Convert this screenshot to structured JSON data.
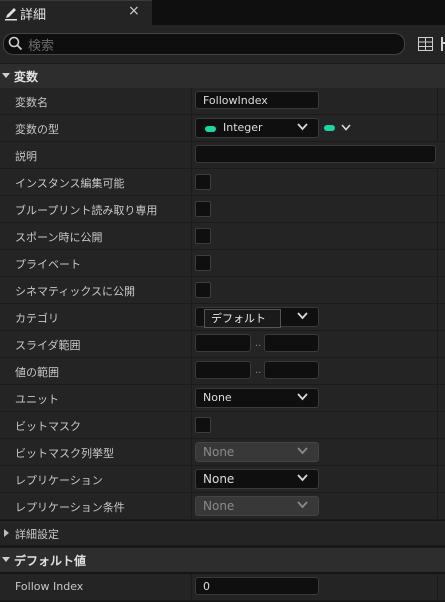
{
  "tab": {
    "title": "詳細",
    "close_glyph": "×"
  },
  "search": {
    "placeholder": "検索"
  },
  "sections": {
    "variables": "変数",
    "advanced": "詳細設定",
    "default_value": "デフォルト値"
  },
  "rows": {
    "variable_name": {
      "label": "変数名",
      "value": "FollowIndex"
    },
    "variable_type": {
      "label": "変数の型",
      "value": "Integer"
    },
    "description": {
      "label": "説明",
      "value": ""
    },
    "instance_editable": {
      "label": "インスタンス編集可能"
    },
    "blueprint_read_only": {
      "label": "ブループリント読み取り専用"
    },
    "expose_on_spawn": {
      "label": "スポーン時に公開"
    },
    "private": {
      "label": "プライベート"
    },
    "expose_to_cinematics": {
      "label": "シネマティックスに公開"
    },
    "category": {
      "label": "カテゴリ",
      "value": "デフォルト"
    },
    "slider_range": {
      "label": "スライダ範囲",
      "separator": ".."
    },
    "value_range": {
      "label": "値の範囲",
      "separator": ".."
    },
    "units": {
      "label": "ユニット",
      "value": "None"
    },
    "bitmask": {
      "label": "ビットマスク"
    },
    "bitmask_enum": {
      "label": "ビットマスク列挙型",
      "value": "None"
    },
    "replication": {
      "label": "レプリケーション",
      "value": "None"
    },
    "replication_condition": {
      "label": "レプリケーション条件",
      "value": "None"
    },
    "follow_index": {
      "label": "Follow Index",
      "value": "0"
    }
  },
  "colors": {
    "type_pill": "#1ed4a0",
    "panel": "#242424",
    "field": "#0f0f0f"
  }
}
